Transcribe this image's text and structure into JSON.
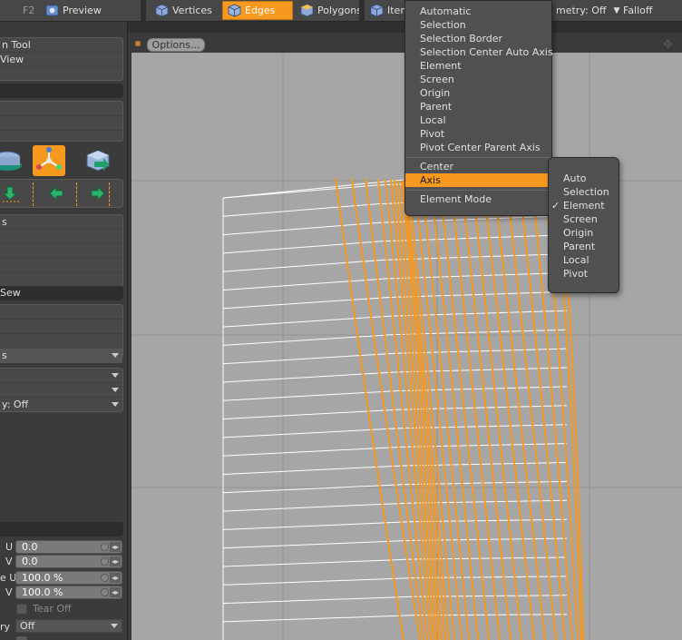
{
  "toolbar": {
    "f2_label": "F2",
    "preview_label": "Preview",
    "vertices_label": "Vertices",
    "edges_label": "Edges",
    "polygons_label": "Polygons",
    "items_label": "Item",
    "symmetry_label": "metry: Off",
    "falloff_label": "Falloff",
    "accent_color": "#f7981f"
  },
  "left_panel": {
    "box1": [
      "n Tool",
      "View",
      ""
    ],
    "box2": [
      "",
      "",
      ""
    ],
    "box3": [
      "s",
      "",
      "",
      "",
      ""
    ],
    "sew_header": "Sew",
    "box4": [
      "",
      "",
      "s"
    ],
    "box5": [
      "",
      "",
      "y: Off"
    ],
    "fields": {
      "u_label": "U",
      "u_value": "0.0",
      "v_label": "V",
      "v_value": "0.0",
      "su_label": "e U",
      "su_value": "100.0 %",
      "sv_label": "V",
      "sv_value": "100.0 %",
      "tear_off": "Tear Off",
      "symmetry_label": "ry",
      "symmetry_value": "Off"
    }
  },
  "viewport": {
    "options_label": "Options..."
  },
  "menu_main": {
    "items_top": [
      "Automatic",
      "Selection",
      "Selection Border",
      "Selection Center Auto Axis",
      "Element",
      "Screen",
      "Origin",
      "Parent",
      "Local",
      "Pivot",
      "Pivot Center Parent Axis"
    ],
    "center": "Center",
    "axis": "Axis",
    "element_mode": "Element Mode"
  },
  "menu_sub": {
    "items": [
      "Auto",
      "Selection",
      "Element",
      "Screen",
      "Origin",
      "Parent",
      "Local",
      "Pivot"
    ],
    "checked": "Element",
    "check_glyph": "✓"
  }
}
